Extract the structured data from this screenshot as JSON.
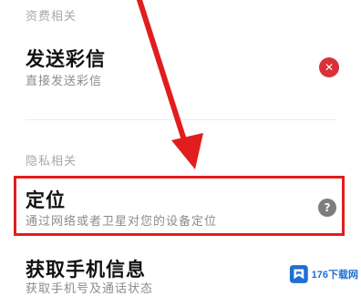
{
  "sections": {
    "fees": {
      "header": "资费相关"
    },
    "privacy": {
      "header": "隐私相关"
    }
  },
  "items": {
    "send_mms": {
      "title": "发送彩信",
      "subtitle": "直接发送彩信",
      "action_icon": "close-icon"
    },
    "location": {
      "title": "定位",
      "subtitle": "通过网络或者卫星对您的设备定位",
      "action_icon": "help-icon"
    },
    "phone_info": {
      "title": "获取手机信息",
      "subtitle": "获取手机号及通话状态"
    }
  },
  "icons": {
    "close": "✕",
    "help": "?"
  },
  "watermark": {
    "text": "176下载网"
  },
  "colors": {
    "highlight": "#e11d1d",
    "close_button": "#d9313a",
    "help_button": "#7d7d7d"
  }
}
